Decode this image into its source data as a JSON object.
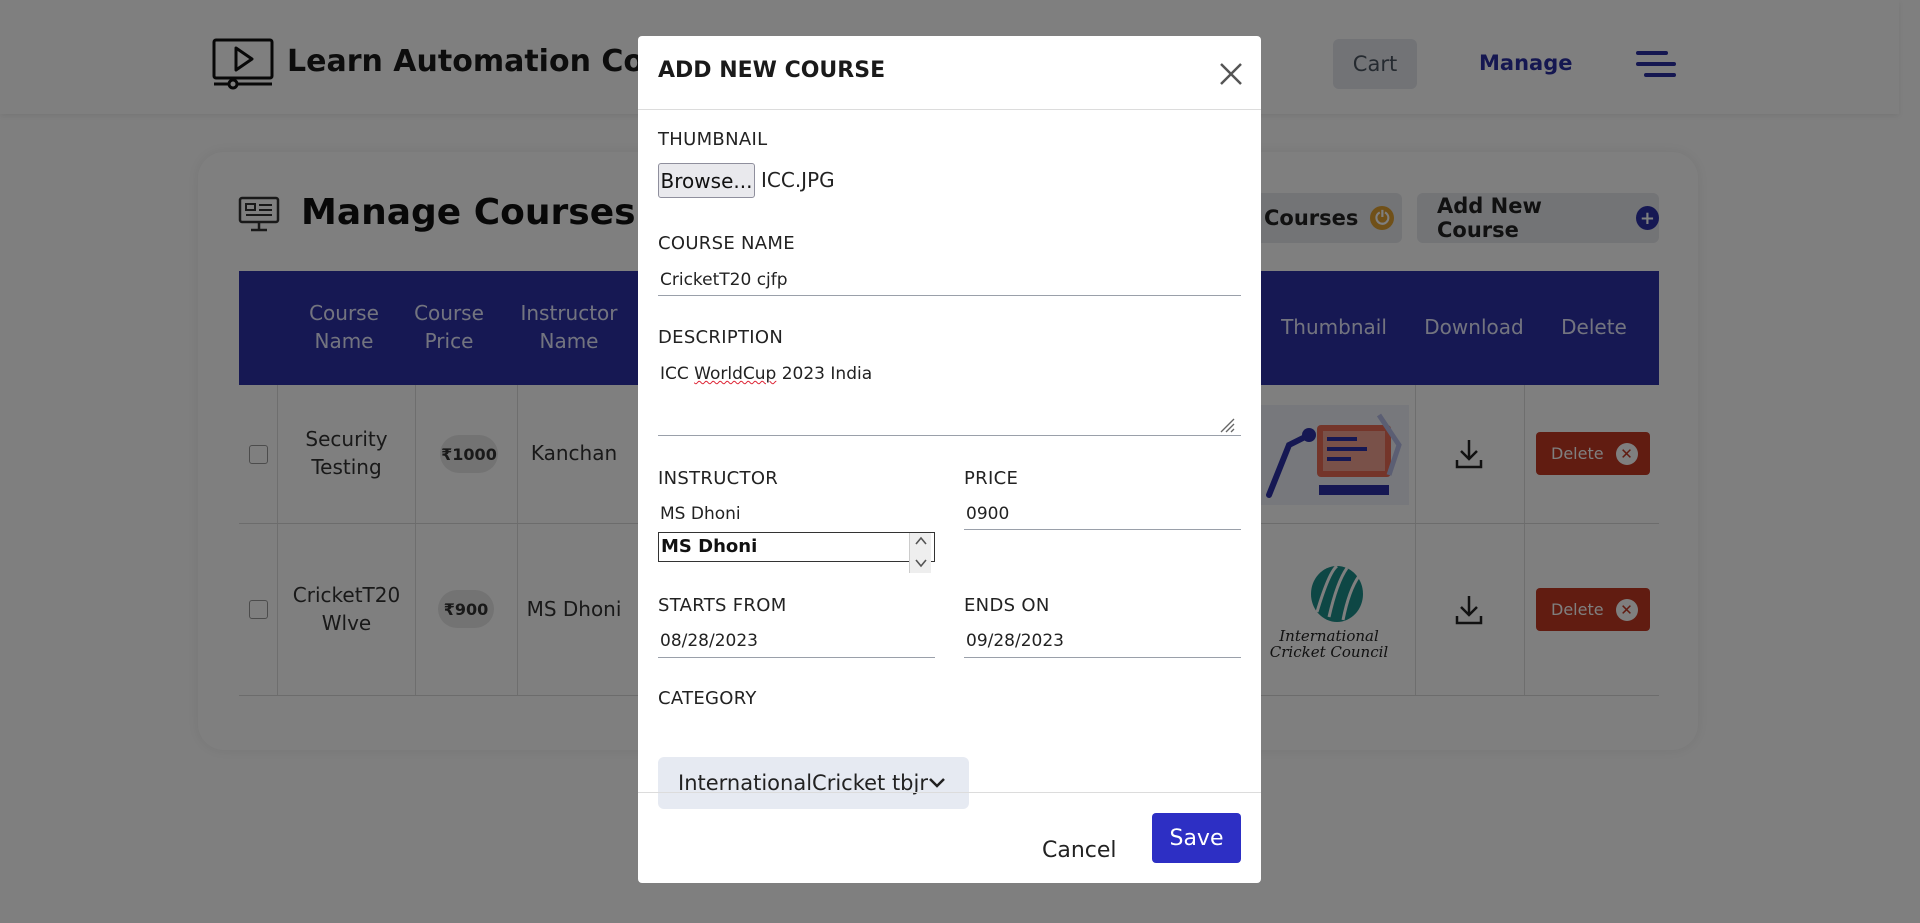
{
  "navbar": {
    "brand": "Learn Automation Courses",
    "cart_label": "Cart",
    "manage_label": "Manage"
  },
  "manage": {
    "title": "Manage Courses",
    "show_courses_label": "Courses",
    "add_course_label": "Add New Course",
    "columns": [
      "Course Name",
      "Course Price",
      "Instructor Name",
      "Thumbnail",
      "Download",
      "Delete"
    ],
    "rows": [
      {
        "course_name": "Security Testing",
        "price": "₹1000",
        "instructor": "Kanchan",
        "delete_label": "Delete"
      },
      {
        "course_name": "CricketT20 Wlve",
        "price": "₹900",
        "instructor": "MS Dhoni",
        "thumb_text_1": "International",
        "thumb_text_2": "Cricket Council",
        "delete_label": "Delete"
      }
    ]
  },
  "modal": {
    "title": "ADD NEW COURSE",
    "thumbnail_label": "THUMBNAIL",
    "browse_label": "Browse...",
    "file_name": "ICC.JPG",
    "course_name_label": "COURSE NAME",
    "course_name_value": "CricketT20 cjfp",
    "description_label": "DESCRIPTION",
    "description_value_pre": "ICC ",
    "description_value_misspelled": "WorldCup",
    "description_value_post": " 2023 India",
    "instructor_label": "INSTRUCTOR",
    "instructor_value": "MS Dhoni",
    "instructor_suggestion": "MS Dhoni",
    "price_label": "PRICE",
    "price_value": "0900",
    "starts_label": "STARTS FROM",
    "starts_value": "08/28/2023",
    "ends_label": "ENDS ON",
    "ends_value": "09/28/2023",
    "category_label": "CATEGORY",
    "category_value": "InternationalCricket tbjr",
    "cancel_label": "Cancel",
    "save_label": "Save"
  },
  "colors": {
    "primary": "#2c31a6",
    "delete": "#c23822",
    "save": "#2d2fc4",
    "warning": "#e0a030"
  }
}
